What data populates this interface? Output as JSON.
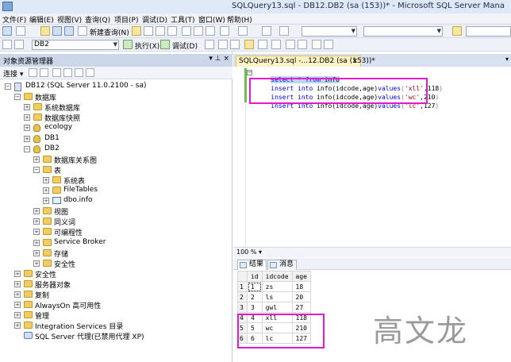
{
  "window": {
    "title": "SQLQuery13.sql - DB12.DB2 (sa (153))* - Microsoft SQL Server Mana"
  },
  "menu": [
    "文件(F)",
    "编辑(E)",
    "视图(V)",
    "查询(Q)",
    "项目(P)",
    "调试(D)",
    "工具(T)",
    "窗口(W)",
    "帮助(H)"
  ],
  "toolbar": {
    "new_query_label": "新建查询(N)",
    "database_selected": "DB2",
    "execute_label": "执行(X)",
    "debug_label": "调试(D)"
  },
  "object_explorer": {
    "title": "对象资源管理器",
    "header_buttons": "▾ ⊥ ×",
    "connect_label": "连接 ▾",
    "nodes": [
      {
        "label": "DB12 (SQL Server 11.0.2100 - sa)",
        "icon": "server-icon",
        "expander": "−",
        "level": 0
      },
      {
        "label": "数据库",
        "icon": "folder-icon",
        "expander": "−",
        "level": 1
      },
      {
        "label": "系统数据库",
        "icon": "folder-icon",
        "expander": "+",
        "level": 2
      },
      {
        "label": "数据库快照",
        "icon": "folder-icon",
        "expander": "+",
        "level": 2
      },
      {
        "label": "ecology",
        "icon": "database-icon",
        "expander": "+",
        "level": 2
      },
      {
        "label": "DB1",
        "icon": "database-icon",
        "expander": "+",
        "level": 2
      },
      {
        "label": "DB2",
        "icon": "database-icon",
        "expander": "−",
        "level": 2
      },
      {
        "label": "数据库关系图",
        "icon": "folder-icon",
        "expander": "+",
        "level": 3
      },
      {
        "label": "表",
        "icon": "folder-icon",
        "expander": "−",
        "level": 3
      },
      {
        "label": "系统表",
        "icon": "folder-icon",
        "expander": "+",
        "level": 4
      },
      {
        "label": "FileTables",
        "icon": "folder-icon",
        "expander": "+",
        "level": 4
      },
      {
        "label": "dbo.info",
        "icon": "table-icon",
        "expander": "+",
        "level": 4
      },
      {
        "label": "视图",
        "icon": "folder-icon",
        "expander": "+",
        "level": 3
      },
      {
        "label": "同义词",
        "icon": "folder-icon",
        "expander": "+",
        "level": 3
      },
      {
        "label": "可编程性",
        "icon": "folder-icon",
        "expander": "+",
        "level": 3
      },
      {
        "label": "Service Broker",
        "icon": "folder-icon",
        "expander": "+",
        "level": 3
      },
      {
        "label": "存储",
        "icon": "folder-icon",
        "expander": "+",
        "level": 3
      },
      {
        "label": "安全性",
        "icon": "folder-icon",
        "expander": "+",
        "level": 3
      },
      {
        "label": "安全性",
        "icon": "folder-icon",
        "expander": "+",
        "level": 1
      },
      {
        "label": "服务器对象",
        "icon": "folder-icon",
        "expander": "+",
        "level": 1
      },
      {
        "label": "复制",
        "icon": "folder-icon",
        "expander": "+",
        "level": 1
      },
      {
        "label": "AlwaysOn 高可用性",
        "icon": "folder-icon",
        "expander": "+",
        "level": 1
      },
      {
        "label": "管理",
        "icon": "folder-icon",
        "expander": "+",
        "level": 1
      },
      {
        "label": "Integration Services 目录",
        "icon": "folder-icon",
        "expander": "+",
        "level": 1
      },
      {
        "label": "SQL Server 代理(已禁用代理 XP)",
        "icon": "agent-icon",
        "expander": "",
        "level": 1
      }
    ]
  },
  "editor": {
    "tab_label": "SQLQuery13.sql -...12.DB2 (sa (153))*",
    "tab_close": "×",
    "tab_dropdown": "▾",
    "line1": {
      "kw1": "select",
      "rest": " * ",
      "kw2": "from",
      "tail": " info"
    },
    "inserts": [
      {
        "kw1": "insert",
        "kw2": "into",
        "mid": " info(idcode,age)",
        "kw3": "values",
        "open": "(",
        "str": "'xll'",
        "num": ",118",
        "close": ")"
      },
      {
        "kw1": "insert",
        "kw2": "into",
        "mid": " info(idcode,age)",
        "kw3": "values",
        "open": "(",
        "str": "'wc'",
        "num": ",210",
        "close": ")"
      },
      {
        "kw1": "insert",
        "kw2": "into",
        "mid": " info(idcode,age)",
        "kw3": "values",
        "open": "(",
        "str": "'lc'",
        "num": ",127",
        "close": ")"
      }
    ]
  },
  "zoom": "100 % ▾",
  "results": {
    "tabs": [
      "结果",
      "消息"
    ],
    "columns": [
      "id",
      "idcode",
      "age"
    ],
    "rows": [
      [
        "1",
        "1",
        "zs",
        "18"
      ],
      [
        "2",
        "2",
        "ls",
        "20"
      ],
      [
        "3",
        "3",
        "gwl",
        "27"
      ],
      [
        "4",
        "4",
        "xll",
        "118"
      ],
      [
        "5",
        "5",
        "wc",
        "210"
      ],
      [
        "6",
        "6",
        "lc",
        "127"
      ]
    ]
  },
  "watermark": "高文龙",
  "colors": {
    "highlight": "#e21bd1",
    "keyword": "#0000ff",
    "string": "#c00000"
  }
}
